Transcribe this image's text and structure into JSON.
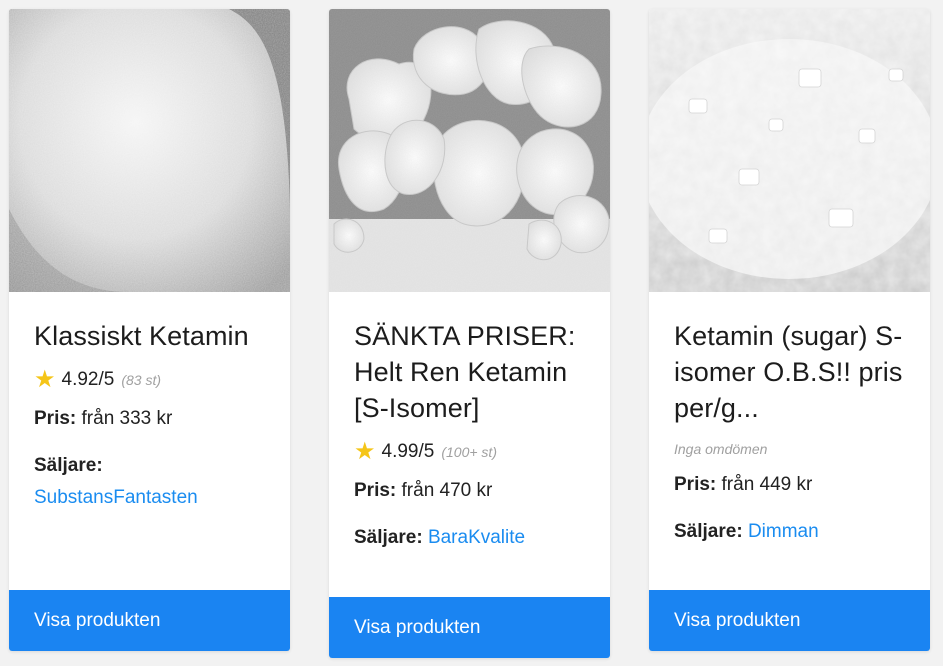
{
  "products": [
    {
      "title": "Klassiskt Ketamin",
      "image_icon": "white-powder-photo",
      "rating": "4.92/5",
      "rating_count": "(83 st)",
      "price_label": "Pris:",
      "price_value": "från 333 kr",
      "seller_label": "Säljare:",
      "seller_name": "SubstansFantasten",
      "button_label": "Visa produkten"
    },
    {
      "title": "SÄNKTA PRISER: Helt Ren Ketamin [S-Isomer]",
      "image_icon": "white-crystal-rocks-photo",
      "rating": "4.99/5",
      "rating_count": "(100+ st)",
      "price_label": "Pris:",
      "price_value": "från 470 kr",
      "seller_label": "Säljare:",
      "seller_name": "BaraKvalite",
      "button_label": "Visa produkten"
    },
    {
      "title": "Ketamin (sugar) S-isomer O.B.S!! pris per/g...",
      "image_icon": "crystal-flakes-photo",
      "no_reviews": "Inga omdömen",
      "price_label": "Pris:",
      "price_value": "från 449 kr",
      "seller_label": "Säljare:",
      "seller_name": "Dimman",
      "button_label": "Visa produkten"
    }
  ],
  "colors": {
    "accent": "#1a84f2",
    "link": "#1a8cf0",
    "star": "#f5c518",
    "background": "#f2f2f2"
  }
}
